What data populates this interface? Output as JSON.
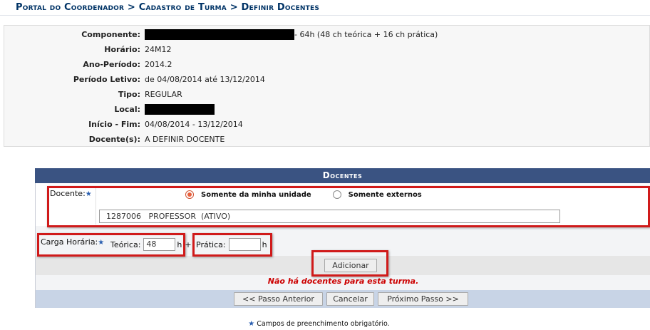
{
  "breadcrumb": {
    "portal": "Portal do Coordenador",
    "sep1": ">",
    "cadastro": "Cadastro de Turma",
    "sep2": ">",
    "current": "Definir Docentes"
  },
  "turma_info": {
    "componente": {
      "label": "Componente:",
      "suffix": "- 64h (48 ch teórica + 16 ch prática)"
    },
    "horario": {
      "label": "Horário:",
      "value": "24M12"
    },
    "ano_periodo": {
      "label": "Ano-Período:",
      "value": "2014.2"
    },
    "periodo_letivo": {
      "label": "Período Letivo:",
      "value": "de 04/08/2014 até 13/12/2014"
    },
    "tipo": {
      "label": "Tipo:",
      "value": "REGULAR"
    },
    "local": {
      "label": "Local:"
    },
    "inicio_fim": {
      "label": "Início - Fim:",
      "value": "04/08/2014 - 13/12/2014"
    },
    "docentes": {
      "label": "Docente(s):",
      "value": "A DEFINIR DOCENTE"
    }
  },
  "docentes_panel": {
    "title": "Docentes",
    "docente_label": "Docente:",
    "radio_options": [
      {
        "label": "Somente da minha unidade",
        "checked": true
      },
      {
        "label": "Somente externos",
        "checked": false
      }
    ],
    "docente_value": "1287006   PROFESSOR  (ATIVO)",
    "carga_label": "Carga Horária:",
    "teorica_label": "Teórica:",
    "teorica_value": "48",
    "h1": "h",
    "plus": "+",
    "pratica_label": "Prática:",
    "pratica_value": "",
    "h2": "h",
    "add_button": "Adicionar",
    "empty_message": "Não há docentes para esta turma.",
    "prev_button": "<< Passo Anterior",
    "cancel_button": "Cancelar",
    "next_button": "Próximo Passo >>"
  },
  "required_star": "★",
  "footnote": "Campos de preenchimento obrigatório.",
  "colors": {
    "title": "#003366",
    "header_bg": "#3a5382",
    "highlight": "#d01a1a",
    "warning": "#cc0000",
    "nav_bg": "#c8d4e6"
  }
}
